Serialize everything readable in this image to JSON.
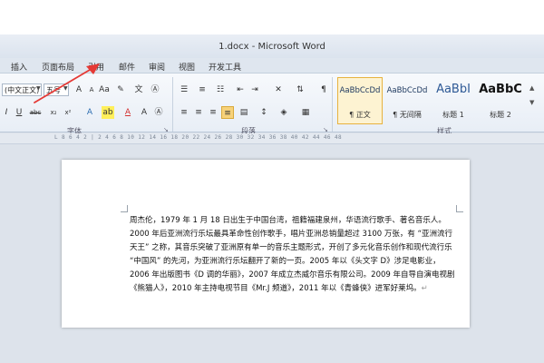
{
  "window": {
    "title": "1.docx - Microsoft Word"
  },
  "tabs": [
    "插入",
    "页面布局",
    "引用",
    "邮件",
    "审阅",
    "视图",
    "开发工具"
  ],
  "font": {
    "name": "(中文正文)",
    "size": "五号"
  },
  "groups": {
    "font": "字体",
    "paragraph": "段落",
    "styles": "样式"
  },
  "styles": [
    {
      "sample": "AaBbCcDd",
      "name": "正文",
      "selected": true
    },
    {
      "sample": "AaBbCcDd",
      "name": "无间隔",
      "selected": false
    },
    {
      "sample": "AaBbI",
      "name": "标题 1",
      "selected": false
    },
    {
      "sample": "AaBbC",
      "name": "标题 2",
      "selected": false
    }
  ],
  "ruler": "L 8 6 4 2 | 2 4 6 8 10 12 14 16 18 20 22 24 26 28 30 32 34 36 38 40 42 44 46 48",
  "document": {
    "text": "周杰伦，1979 年 1 月 18 日出生于中国台湾，祖籍福建泉州，华语流行歌手、著名音乐人。2000 年后亚洲流行乐坛最具革命性创作歌手，唱片亚洲总销量超过 3100 万张，有 “亚洲流行天王” 之称，其音乐突破了亚洲原有单一的音乐主题形式，开创了多元化音乐创作和现代流行乐 “中国风” 的先河，为亚洲流行乐坛翻开了新的一页。2005 年以《头文字 D》涉足电影业，2006 年出版图书《D 调的华丽》，2007 年成立杰威尔音乐有限公司。2009 年自导自演电视剧《熊猫人》，2010 年主持电视节目《Mr.J 频道》，2011 年以《青蜂侠》进军好莱坞。"
  },
  "colors": {
    "annotation_arrow": "#e53935",
    "selected_style": "#e8b23e",
    "page_bg": "#ffffff",
    "workspace": "#dde3eb"
  }
}
